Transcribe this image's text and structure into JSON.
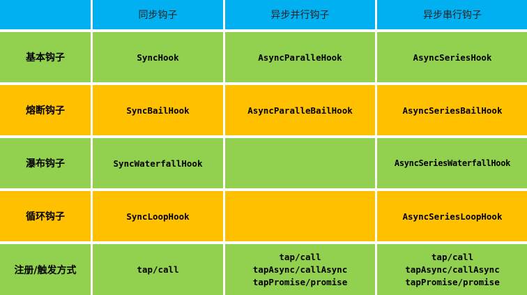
{
  "header": {
    "corner": "",
    "col_sync": "同步钩子",
    "col_async_parallel": "异步并行钩子",
    "col_async_series": "异步串行钩子"
  },
  "rows": [
    {
      "label": "基本钩子",
      "sync": "SyncHook",
      "async_parallel": "AsyncParalleHook",
      "async_series": "AsyncSeriesHook"
    },
    {
      "label": "熔断钩子",
      "sync": "SyncBailHook",
      "async_parallel": "AsyncParalleBailHook",
      "async_series": "AsyncSeriesBailHook"
    },
    {
      "label": "瀑布钩子",
      "sync": "SyncWaterfallHook",
      "async_parallel": "",
      "async_series": "AsyncSeriesWaterfallHook"
    },
    {
      "label": "循环钩子",
      "sync": "SyncLoopHook",
      "async_parallel": "",
      "async_series": "AsyncSeriesLoopHook"
    }
  ],
  "register_row": {
    "label": "注册/触发方式",
    "sync": "tap/call",
    "async_parallel": [
      "tap/call",
      "tapAsync/callAsync",
      "tapPromise/promise"
    ],
    "async_series": [
      "tap/call",
      "tapAsync/callAsync",
      "tapPromise/promise"
    ]
  },
  "colors": {
    "header_blue": "#00b0f0",
    "row_green": "#92d050",
    "row_orange": "#ffc000"
  }
}
